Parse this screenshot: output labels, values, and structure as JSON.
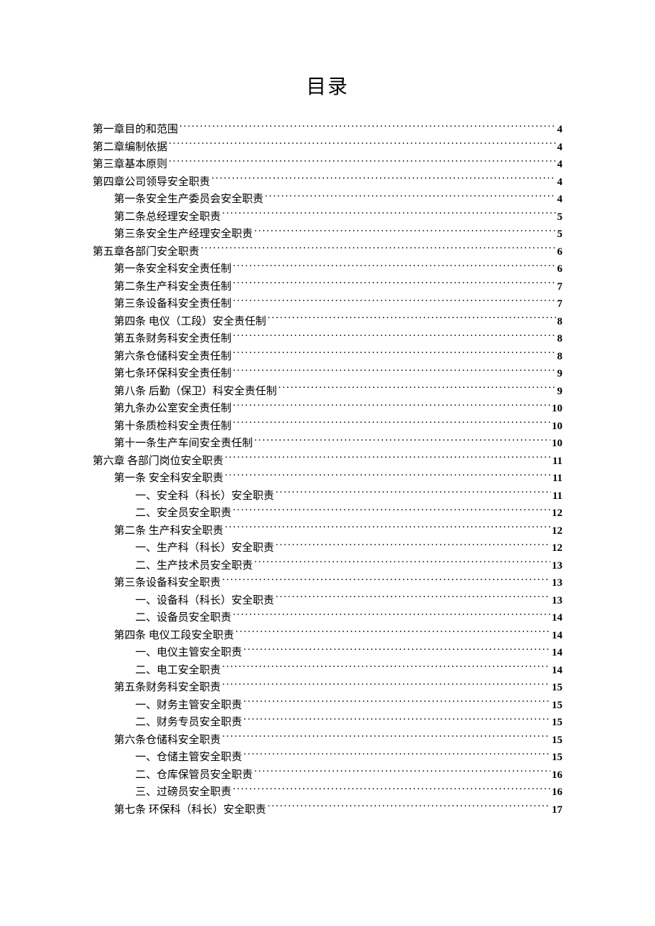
{
  "title": "目录",
  "toc": [
    {
      "level": 0,
      "label": "第一章目的和范围",
      "page": "4"
    },
    {
      "level": 0,
      "label": "第二章编制依据",
      "page": "4"
    },
    {
      "level": 0,
      "label": "第三章基本原则",
      "page": "4"
    },
    {
      "level": 0,
      "label": "第四章公司领导安全职责",
      "page": "4"
    },
    {
      "level": 1,
      "label": "第一条安全生产委员会安全职责",
      "page": "4"
    },
    {
      "level": 1,
      "label": "第二条总经理安全职责",
      "page": "5"
    },
    {
      "level": 1,
      "label": "第三条安全生产经理安全职责",
      "page": "5"
    },
    {
      "level": 0,
      "label": "第五章各部门安全职责",
      "page": "6"
    },
    {
      "level": 1,
      "label": "第一条安全科安全责任制",
      "page": "6"
    },
    {
      "level": 1,
      "label": "第二条生产科安全责任制",
      "page": "7"
    },
    {
      "level": 1,
      "label": "第三条设备科安全责任制",
      "page": "7"
    },
    {
      "level": 1,
      "label": "第四条 电仪（工段）安全责任制",
      "page": "8"
    },
    {
      "level": 1,
      "label": "第五条财务科安全责任制",
      "page": "8"
    },
    {
      "level": 1,
      "label": "第六条仓储科安全责任制",
      "page": "8"
    },
    {
      "level": 1,
      "label": "第七条环保科安全责任制",
      "page": "9"
    },
    {
      "level": 1,
      "label": "第八条 后勤（保卫）科安全责任制",
      "page": "9"
    },
    {
      "level": 1,
      "label": "第九条办公室安全责任制",
      "page": "10"
    },
    {
      "level": 1,
      "label": "第十条质检科安全责任制",
      "page": "10"
    },
    {
      "level": 1,
      "label": "第十一条生产车间安全责任制",
      "page": "10"
    },
    {
      "level": 0,
      "label": "第六章 各部门岗位安全职责",
      "page": "11"
    },
    {
      "level": 1,
      "label": "第一条 安全科安全职责",
      "page": "11"
    },
    {
      "level": 2,
      "label": "一、安全科（科长）安全职责",
      "page": "11"
    },
    {
      "level": 2,
      "label": "二、安全员安全职责",
      "page": "12"
    },
    {
      "level": 1,
      "label": "第二条 生产科安全职责",
      "page": "12"
    },
    {
      "level": 2,
      "label": "一、生产科（科长）安全职责",
      "page": "12"
    },
    {
      "level": 2,
      "label": "二、生产技术员安全职责",
      "page": "13"
    },
    {
      "level": 1,
      "label": "第三条设备科安全职责",
      "page": "13"
    },
    {
      "level": 2,
      "label": "一、设备科（科长）安全职责",
      "page": "13"
    },
    {
      "level": 2,
      "label": "二、设备员安全职责",
      "page": "14"
    },
    {
      "level": 1,
      "label": "第四条 电仪工段安全职责",
      "page": "14"
    },
    {
      "level": 2,
      "label": "一、电仪主管安全职责",
      "page": "14"
    },
    {
      "level": 2,
      "label": "二、电工安全职责",
      "page": "14"
    },
    {
      "level": 1,
      "label": "第五条财务科安全职责",
      "page": "15"
    },
    {
      "level": 2,
      "label": "一、财务主管安全职责",
      "page": "15"
    },
    {
      "level": 2,
      "label": "二、财务专员安全职责",
      "page": "15"
    },
    {
      "level": 1,
      "label": "第六条仓储科安全职责",
      "page": "15"
    },
    {
      "level": 2,
      "label": "一、仓储主管安全职责",
      "page": "15"
    },
    {
      "level": 2,
      "label": "二、仓库保管员安全职责",
      "page": "16"
    },
    {
      "level": 2,
      "label": "三、过磅员安全职责",
      "page": "16"
    },
    {
      "level": 1,
      "label": "第七条 环保科（科长）安全职责",
      "page": "17"
    }
  ]
}
